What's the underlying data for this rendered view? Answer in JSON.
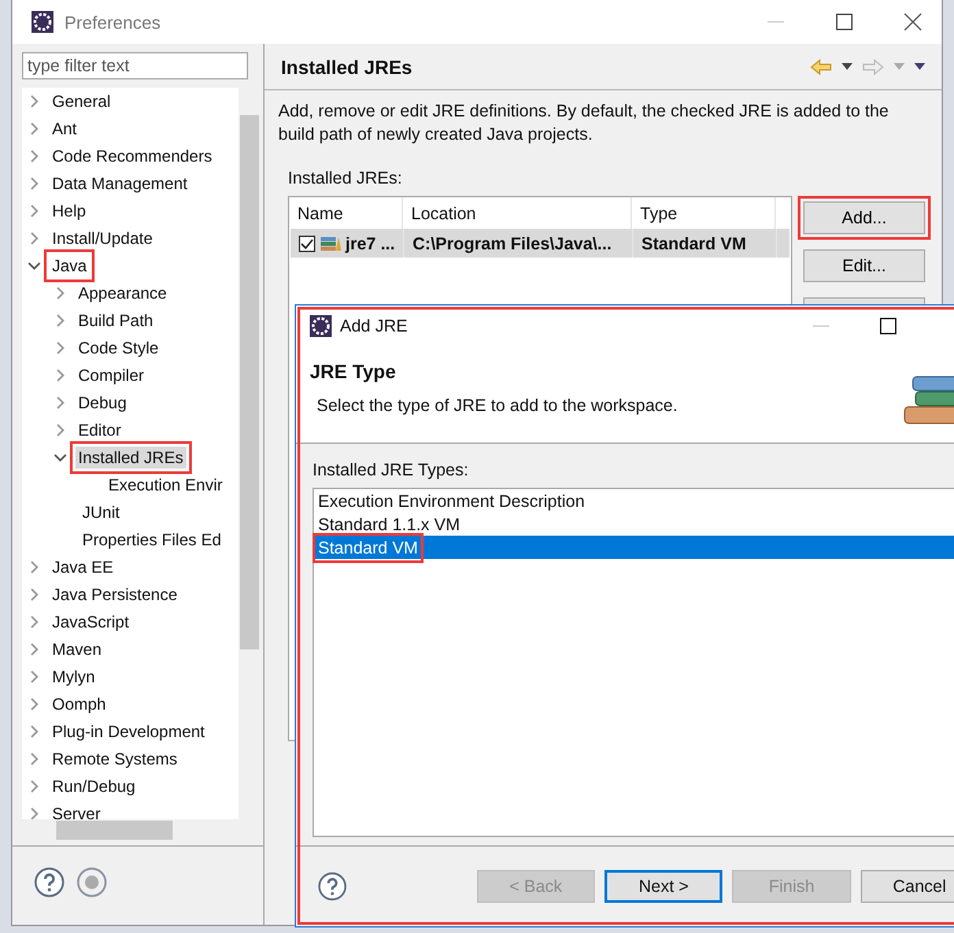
{
  "window": {
    "title": "Preferences"
  },
  "filter": {
    "placeholder": "type filter text"
  },
  "tree": [
    {
      "label": "General",
      "kind": "folder",
      "expanded": false,
      "selected": false,
      "highlighted": false
    },
    {
      "label": "Ant",
      "kind": "folder",
      "expanded": false,
      "selected": false,
      "highlighted": false
    },
    {
      "label": "Code Recommenders",
      "kind": "folder",
      "expanded": false,
      "selected": false,
      "highlighted": false
    },
    {
      "label": "Data Management",
      "kind": "folder",
      "expanded": false,
      "selected": false,
      "highlighted": false
    },
    {
      "label": "Help",
      "kind": "folder",
      "expanded": false,
      "selected": false,
      "highlighted": false
    },
    {
      "label": "Install/Update",
      "kind": "folder",
      "expanded": false,
      "selected": false,
      "highlighted": false
    },
    {
      "label": "Java",
      "kind": "folder",
      "expanded": true,
      "selected": false,
      "highlighted": true,
      "children": [
        {
          "label": "Appearance",
          "kind": "folder",
          "expanded": false,
          "selected": false,
          "highlighted": false
        },
        {
          "label": "Build Path",
          "kind": "folder",
          "expanded": false,
          "selected": false,
          "highlighted": false
        },
        {
          "label": "Code Style",
          "kind": "folder",
          "expanded": false,
          "selected": false,
          "highlighted": false
        },
        {
          "label": "Compiler",
          "kind": "folder",
          "expanded": false,
          "selected": false,
          "highlighted": false
        },
        {
          "label": "Debug",
          "kind": "folder",
          "expanded": false,
          "selected": false,
          "highlighted": false
        },
        {
          "label": "Editor",
          "kind": "folder",
          "expanded": false,
          "selected": false,
          "highlighted": false
        },
        {
          "label": "Installed JREs",
          "kind": "folder",
          "expanded": true,
          "selected": true,
          "highlighted": true,
          "children": [
            {
              "label": "Execution Envir",
              "kind": "leaf",
              "selected": false,
              "highlighted": false
            }
          ]
        },
        {
          "label": "JUnit",
          "kind": "leaf",
          "selected": false,
          "highlighted": false
        },
        {
          "label": "Properties Files Ed",
          "kind": "leaf",
          "selected": false,
          "highlighted": false
        }
      ]
    },
    {
      "label": "Java EE",
      "kind": "folder",
      "expanded": false,
      "selected": false,
      "highlighted": false
    },
    {
      "label": "Java Persistence",
      "kind": "folder",
      "expanded": false,
      "selected": false,
      "highlighted": false
    },
    {
      "label": "JavaScript",
      "kind": "folder",
      "expanded": false,
      "selected": false,
      "highlighted": false
    },
    {
      "label": "Maven",
      "kind": "folder",
      "expanded": false,
      "selected": false,
      "highlighted": false
    },
    {
      "label": "Mylyn",
      "kind": "folder",
      "expanded": false,
      "selected": false,
      "highlighted": false
    },
    {
      "label": "Oomph",
      "kind": "folder",
      "expanded": false,
      "selected": false,
      "highlighted": false
    },
    {
      "label": "Plug-in Development",
      "kind": "folder",
      "expanded": false,
      "selected": false,
      "highlighted": false
    },
    {
      "label": "Remote Systems",
      "kind": "folder",
      "expanded": false,
      "selected": false,
      "highlighted": false
    },
    {
      "label": "Run/Debug",
      "kind": "folder",
      "expanded": false,
      "selected": false,
      "highlighted": false
    },
    {
      "label": "Server",
      "kind": "folder",
      "expanded": false,
      "selected": false,
      "highlighted": false
    }
  ],
  "page": {
    "title": "Installed JREs",
    "description": "Add, remove or edit JRE definitions. By default, the checked JRE is added to the build path of newly created Java projects.",
    "table_label": "Installed JREs:",
    "table": {
      "columns": [
        "Name",
        "Location",
        "Type"
      ],
      "rows": [
        {
          "checked": true,
          "name": "jre7 ...",
          "location": "C:\\Program Files\\Java\\...",
          "type": "Standard VM"
        }
      ]
    },
    "buttons": [
      {
        "label": "Add...",
        "highlighted": true
      },
      {
        "label": "Edit...",
        "highlighted": false
      }
    ]
  },
  "dialog": {
    "title": "Add JRE",
    "highlighted": true,
    "heading": "JRE Type",
    "subtitle": "Select the type of JRE to add to the workspace.",
    "list_label": "Installed JRE Types:",
    "types": [
      {
        "label": "Execution Environment Description",
        "selected": false,
        "highlighted": false
      },
      {
        "label": "Standard 1.1.x VM",
        "selected": false,
        "highlighted": false
      },
      {
        "label": "Standard VM",
        "selected": true,
        "highlighted": true
      }
    ],
    "buttons": [
      {
        "label": "< Back",
        "disabled": true,
        "default": false
      },
      {
        "label": "Next >",
        "disabled": false,
        "default": true
      },
      {
        "label": "Finish",
        "disabled": true,
        "default": false
      },
      {
        "label": "Cancel",
        "disabled": false,
        "default": false
      }
    ]
  }
}
